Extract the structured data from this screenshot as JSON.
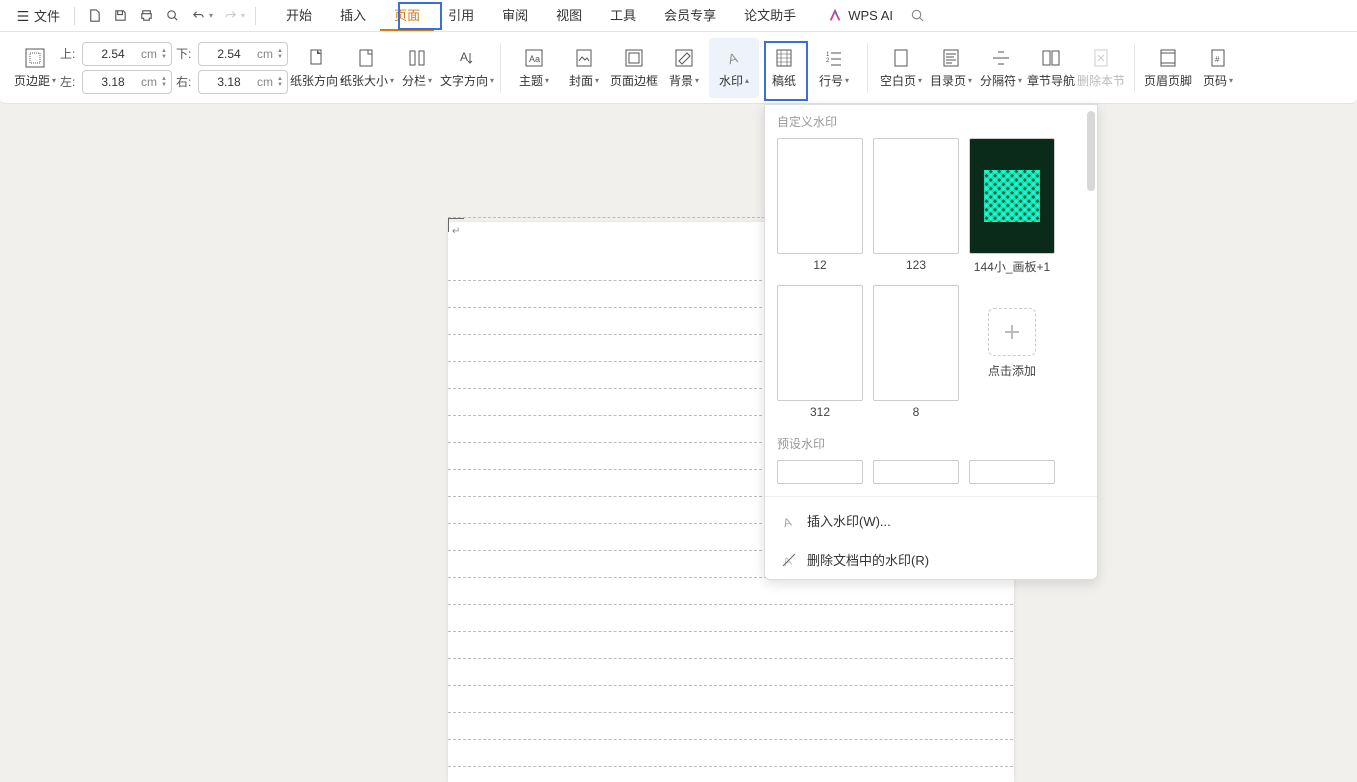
{
  "menu": {
    "file": "文件",
    "tabs": [
      "开始",
      "插入",
      "页面",
      "引用",
      "审阅",
      "视图",
      "工具",
      "会员专享",
      "论文助手"
    ],
    "active_tab": "页面",
    "wps_ai": "WPS AI"
  },
  "ribbon": {
    "page_margin": "页边距",
    "margins": {
      "top": "2.54",
      "bottom": "2.54",
      "left": "3.18",
      "right": "3.18",
      "unit": "cm"
    },
    "labels": {
      "top": "上:",
      "bottom": "下:",
      "left": "左:",
      "right": "右:"
    },
    "paper_direction": "纸张方向",
    "paper_size": "纸张大小",
    "columns": "分栏",
    "text_direction": "文字方向",
    "theme": "主题",
    "cover": "封面",
    "page_border": "页面边框",
    "background": "背景",
    "watermark": "水印",
    "draft_paper": "稿纸",
    "line_number": "行号",
    "blank_page": "空白页",
    "toc_page": "目录页",
    "separator": "分隔符",
    "chapter_nav": "章节导航",
    "delete_section": "删除本节",
    "header_footer": "页眉页脚",
    "page_number": "页码"
  },
  "dropdown": {
    "custom_header": "自定义水印",
    "items": [
      {
        "label": "12"
      },
      {
        "label": "123"
      },
      {
        "label": "144小_画板+1"
      },
      {
        "label": "312"
      },
      {
        "label": "8"
      }
    ],
    "add_label": "点击添加",
    "preset_header": "预设水印",
    "insert_watermark": "插入水印(W)...",
    "remove_watermark": "删除文档中的水印(R)"
  }
}
